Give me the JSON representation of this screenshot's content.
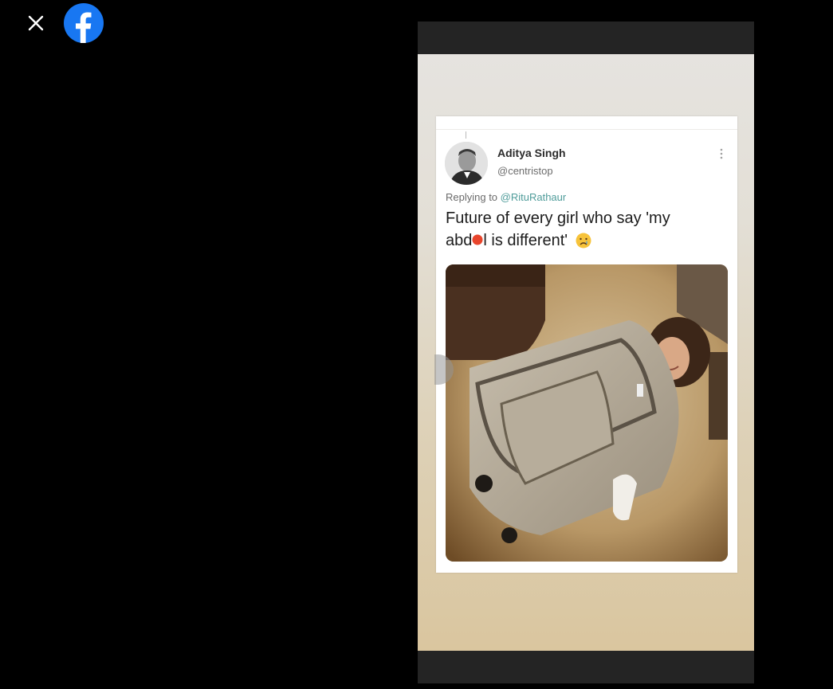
{
  "viewer": {
    "close_icon": "close-icon",
    "app_icon": "facebook-logo-icon",
    "brand_color": "#1877f2",
    "background": "#000000"
  },
  "story": {
    "frame_bar_color": "#242424",
    "tweet": {
      "author_name": "Aditya Singh",
      "author_handle": "@centristop",
      "reply_prefix": "Replying to ",
      "reply_target": "@RituRathaur",
      "text_line1": "Future of every girl who say 'my",
      "text_line2_a": "abd",
      "text_line2_b": "l is different'",
      "emoji_icon": "crying-face-icon",
      "more_icon": "vertical-dots-icon",
      "media_description_icon": "suitcase-photo",
      "link_color": "#4f9c9a"
    }
  }
}
